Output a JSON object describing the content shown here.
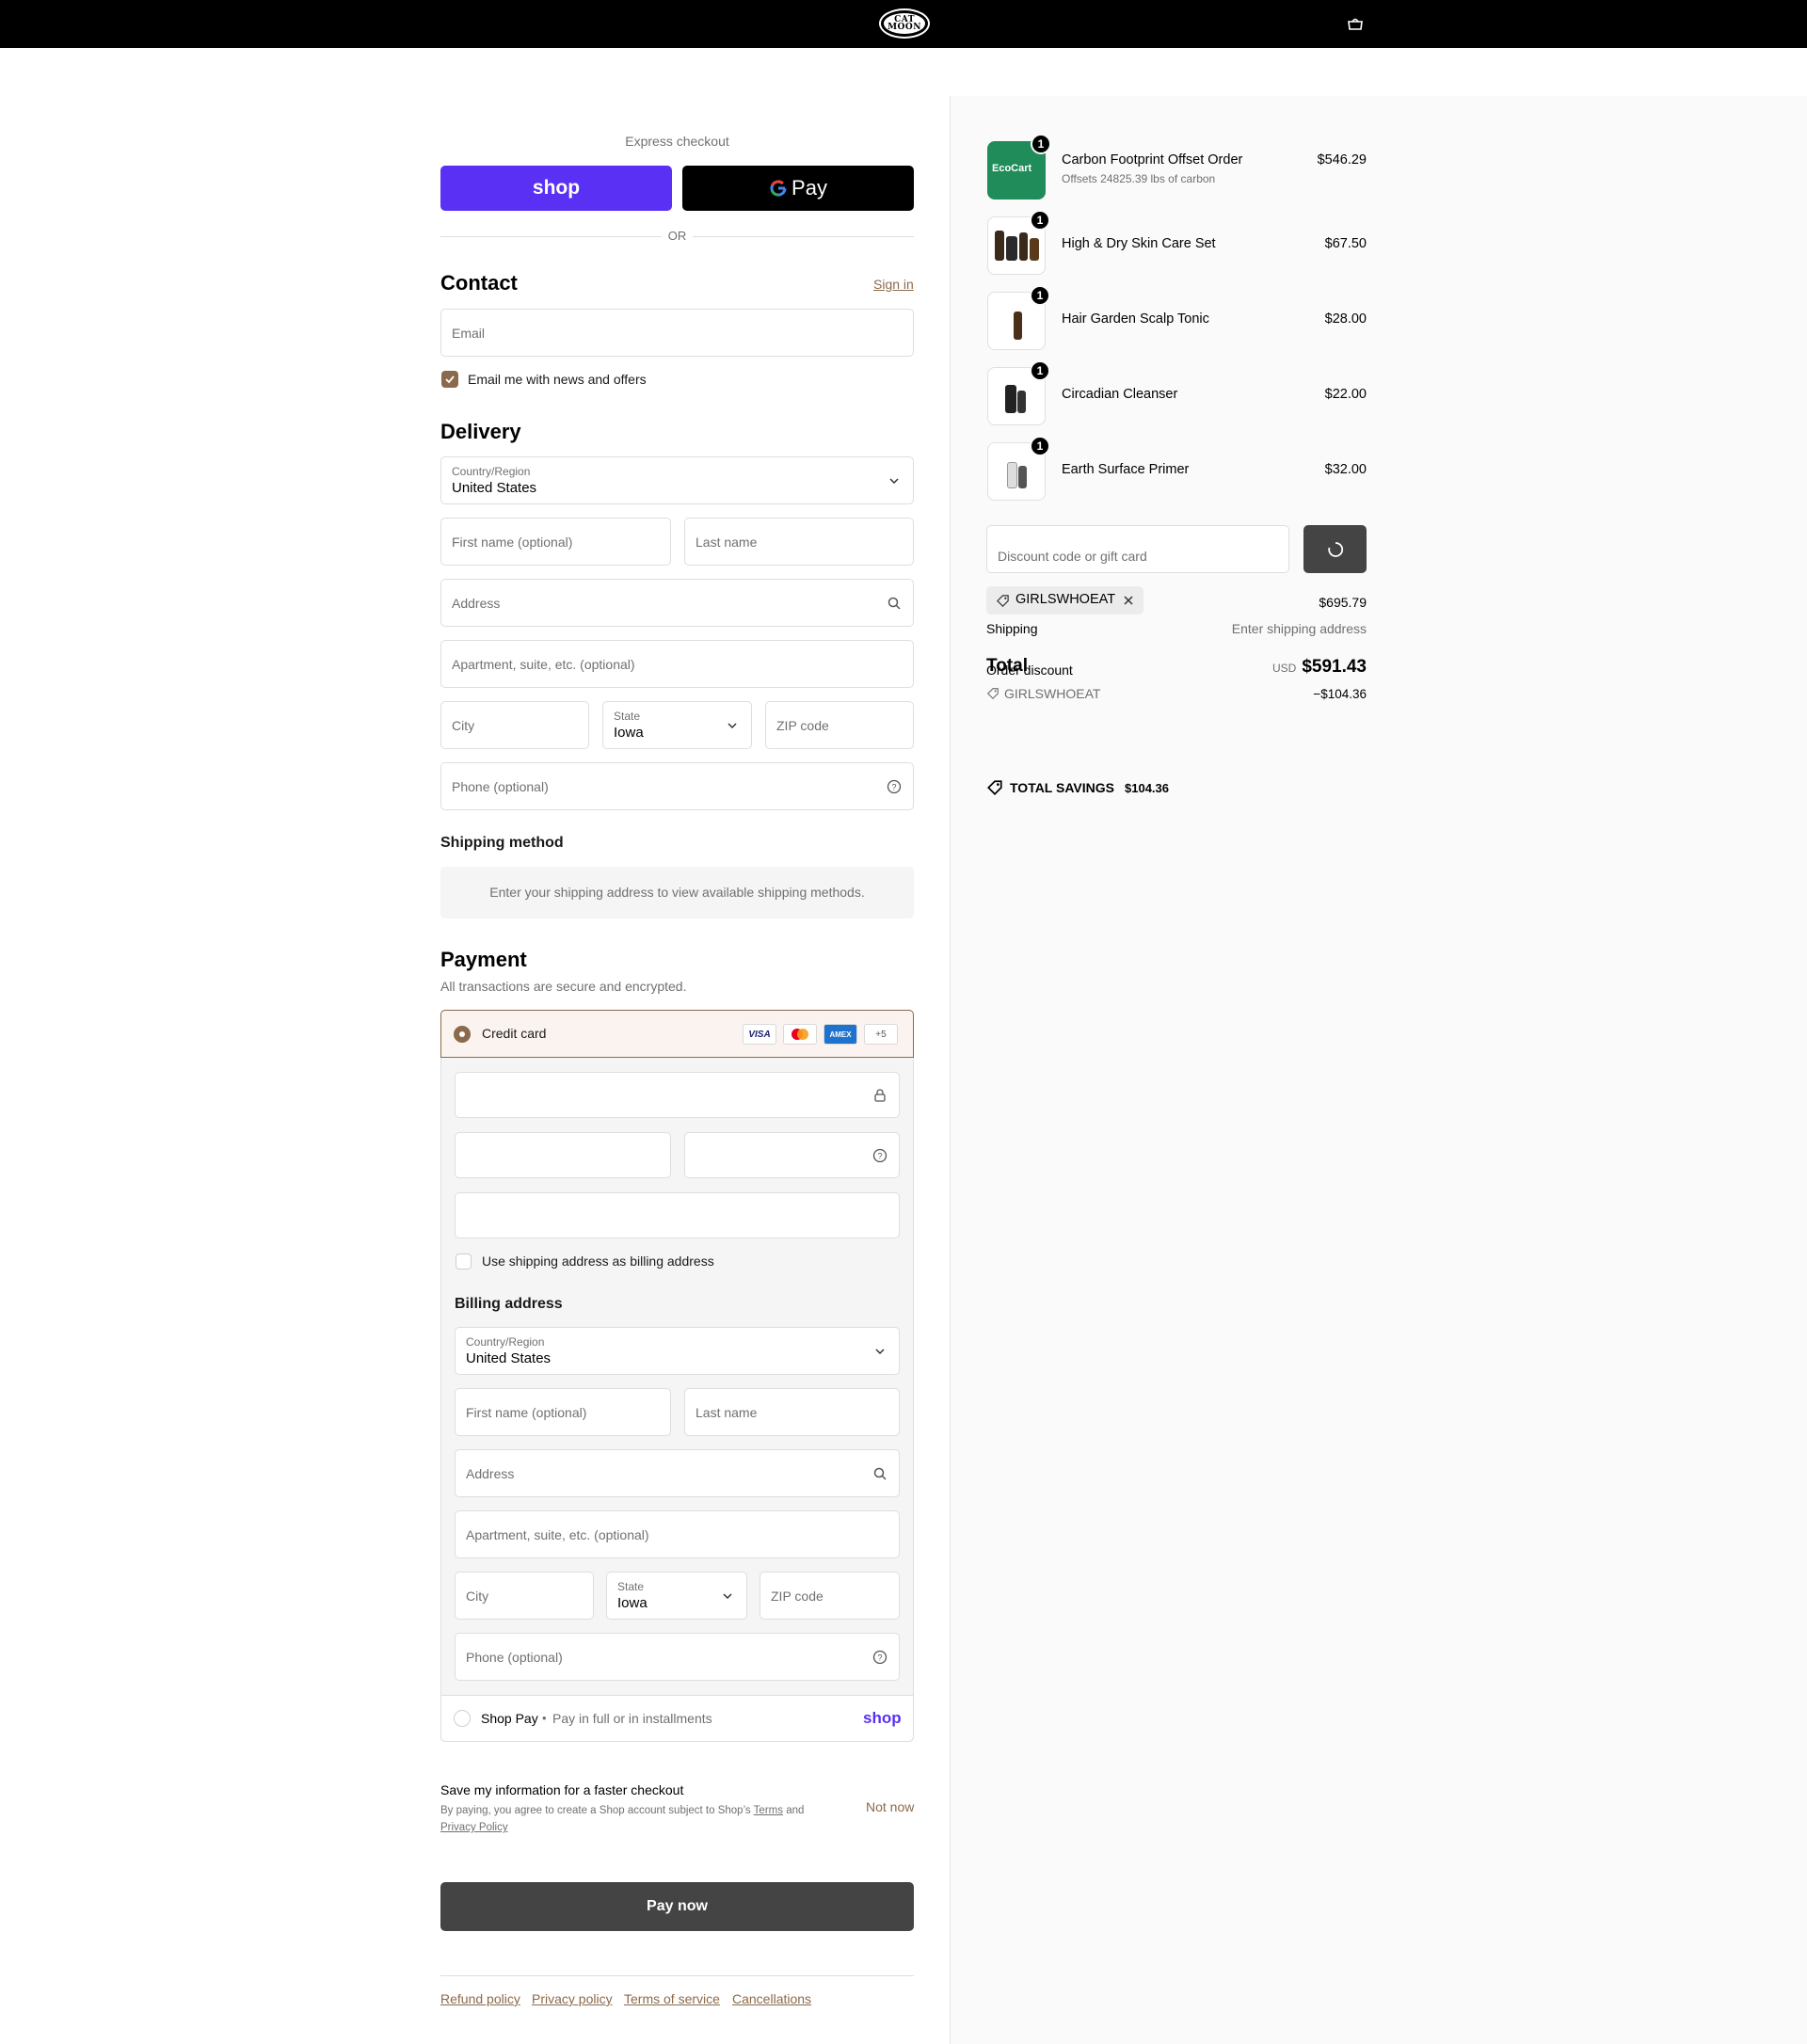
{
  "header": {
    "logo_text_top": "CAT",
    "logo_text_bottom": "MOON"
  },
  "express": {
    "title": "Express checkout",
    "shop_label": "shop",
    "gpay_label": "Pay",
    "or_label": "OR"
  },
  "contact": {
    "title": "Contact",
    "sign_in": "Sign in",
    "email_placeholder": "Email",
    "news_label": "Email me with news and offers"
  },
  "delivery": {
    "title": "Delivery",
    "country_label": "Country/Region",
    "country_value": "United States",
    "first_name": "First name (optional)",
    "last_name": "Last name",
    "address": "Address",
    "apartment": "Apartment, suite, etc. (optional)",
    "city": "City",
    "state_label": "State",
    "state_value": "Iowa",
    "zip": "ZIP code",
    "phone": "Phone (optional)"
  },
  "shipping_method": {
    "title": "Shipping method",
    "notice": "Enter your shipping address to view available shipping methods."
  },
  "payment": {
    "title": "Payment",
    "subtitle": "All transactions are secure and encrypted.",
    "credit_card_label": "Credit card",
    "card_logos": [
      "VISA",
      "",
      "AMEX",
      "+5"
    ],
    "use_shipping_label": "Use shipping address as billing address",
    "billing_title": "Billing address",
    "shop_pay_label": "Shop Pay",
    "shop_pay_sub": "Pay in full or in installments",
    "shop_pay_logo": "shop"
  },
  "billing": {
    "country_label": "Country/Region",
    "country_value": "United States",
    "first_name": "First name (optional)",
    "last_name": "Last name",
    "address": "Address",
    "apartment": "Apartment, suite, etc. (optional)",
    "city": "City",
    "state_label": "State",
    "state_value": "Iowa",
    "zip": "ZIP code",
    "phone": "Phone (optional)"
  },
  "save_info": {
    "title": "Save my information for a faster checkout",
    "legal_prefix": "By paying, you agree to create a Shop account subject to Shop’s",
    "terms": "Terms",
    "and": "and",
    "privacy": "Privacy Policy",
    "not_now": "Not now"
  },
  "pay_now": "Pay now",
  "footer_links": [
    "Refund policy",
    "Privacy policy",
    "Terms of service",
    "Cancellations"
  ],
  "cart": {
    "items": [
      {
        "name": "Carbon Footprint Offset Order",
        "sub": "Offsets 24825.39 lbs of carbon",
        "price": "$546.29",
        "qty": "1",
        "thumb_text": "EcoCart"
      },
      {
        "name": "High & Dry Skin Care Set",
        "price": "$67.50",
        "qty": "1"
      },
      {
        "name": "Hair Garden Scalp Tonic",
        "price": "$28.00",
        "qty": "1"
      },
      {
        "name": "Circadian Cleanser",
        "price": "$22.00",
        "qty": "1"
      },
      {
        "name": "Earth Surface Primer",
        "price": "$32.00",
        "qty": "1"
      }
    ],
    "discount_placeholder": "Discount code or gift card",
    "applied_code": "GIRLSWHOEAT",
    "subtotal": "$695.79",
    "shipping_label": "Shipping",
    "shipping_value": "Enter shipping address",
    "total_label": "Total",
    "order_discount_label": "Order discount",
    "currency": "USD",
    "total_value": "$591.43",
    "discount_code": "GIRLSWHOEAT",
    "discount_value": "−$104.36",
    "savings_label": "TOTAL SAVINGS",
    "savings_value": "$104.36"
  },
  "colors": {
    "accent": "#8a6a4a",
    "shop_purple": "#5a31f4",
    "pay_button": "#444444"
  }
}
